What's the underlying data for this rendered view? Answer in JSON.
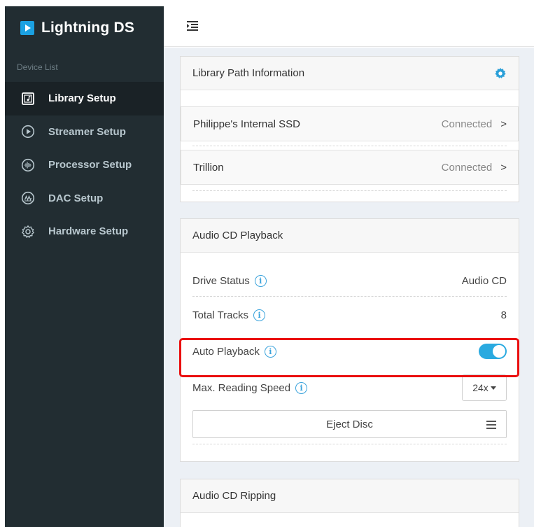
{
  "brand": {
    "title": "Lightning DS",
    "accent": "#1ba1e2"
  },
  "sidebar": {
    "section_label": "Device List",
    "items": [
      {
        "label": "Library Setup",
        "icon": "music-library-icon",
        "active": true
      },
      {
        "label": "Streamer Setup",
        "icon": "play-circle-icon",
        "active": false
      },
      {
        "label": "Processor Setup",
        "icon": "waveform-icon",
        "active": false
      },
      {
        "label": "DAC Setup",
        "icon": "dac-icon",
        "active": false
      },
      {
        "label": "Hardware Setup",
        "icon": "gear-icon",
        "active": false
      }
    ]
  },
  "topbar": {
    "toggle_icon": "sidebar-toggle-icon"
  },
  "library_path": {
    "title": "Library Path Information",
    "settings_icon": "gear-icon",
    "storages": [
      {
        "name": "Philippe's Internal SSD",
        "status": "Connected",
        "chevron": ">"
      },
      {
        "name": "Trillion",
        "status": "Connected",
        "chevron": ">"
      }
    ]
  },
  "cd_playback": {
    "title": "Audio CD Playback",
    "drive_status": {
      "label": "Drive Status",
      "value": "Audio CD"
    },
    "total_tracks": {
      "label": "Total Tracks",
      "value": "8"
    },
    "auto_playback": {
      "label": "Auto Playback",
      "enabled": true
    },
    "max_speed": {
      "label": "Max. Reading Speed",
      "value": "24x"
    },
    "eject_label": "Eject Disc",
    "info_glyph": "i"
  },
  "cd_ripping": {
    "title": "Audio CD Ripping"
  },
  "colors": {
    "sidebar_bg": "#222d32",
    "toggle_on": "#2aaae0",
    "highlight": "#ea0f0f",
    "info": "#3aa3dc"
  }
}
